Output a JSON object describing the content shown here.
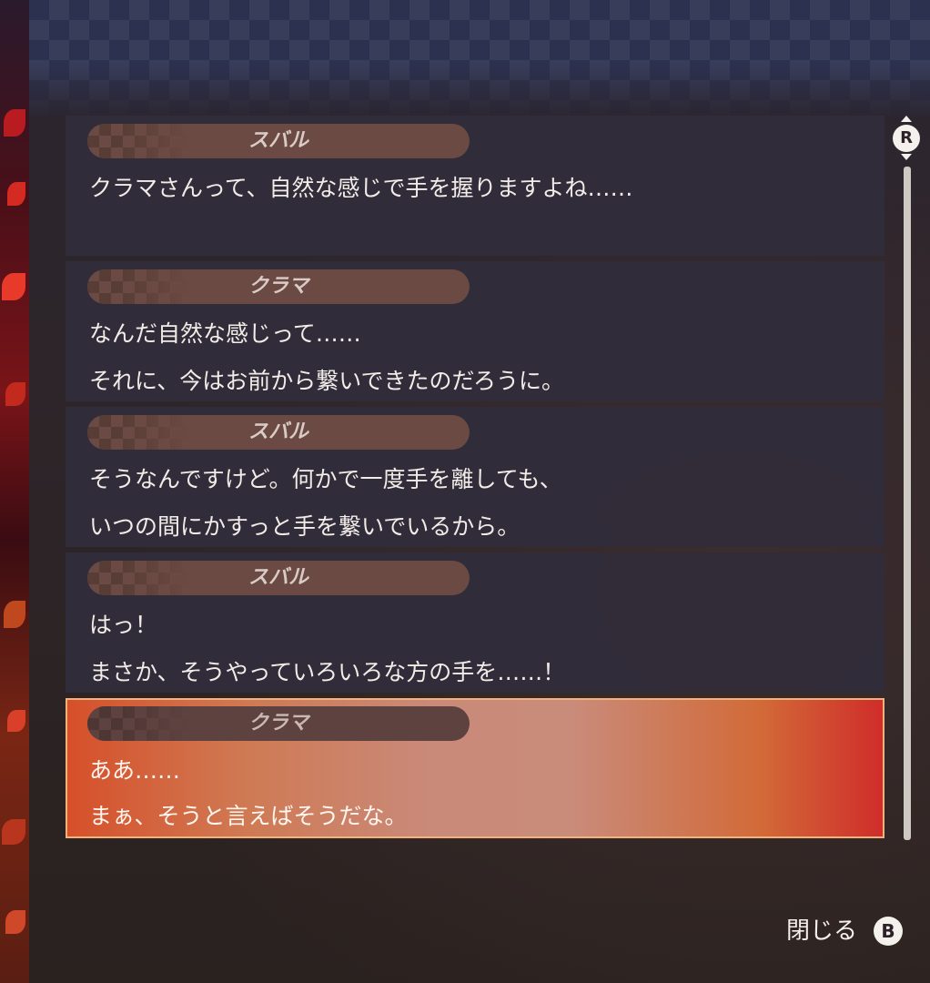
{
  "log_entries": [
    {
      "speaker": "スバル",
      "lines": [
        "クラマさんって、自然な感じで手を握りますよね……",
        ""
      ],
      "active": false
    },
    {
      "speaker": "クラマ",
      "lines": [
        "なんだ自然な感じって……",
        "それに、今はお前から繋いできたのだろうに。"
      ],
      "active": false
    },
    {
      "speaker": "スバル",
      "lines": [
        "そうなんですけど。何かで一度手を離しても、",
        "いつの間にかすっと手を繋いでいるから。"
      ],
      "active": false
    },
    {
      "speaker": "スバル",
      "lines": [
        "はっ！",
        "まさか、そうやっていろいろな方の手を……！"
      ],
      "active": false
    },
    {
      "speaker": "クラマ",
      "lines": [
        "ああ……",
        "まぁ、そうと言えばそうだな。"
      ],
      "active": true
    }
  ],
  "scroll": {
    "button_label": "R"
  },
  "close": {
    "label": "閉じる",
    "button_label": "B"
  },
  "colors": {
    "active_border": "#f2b27a",
    "entry_bg": "#322c3a",
    "name_plate": "#6a4a42"
  }
}
